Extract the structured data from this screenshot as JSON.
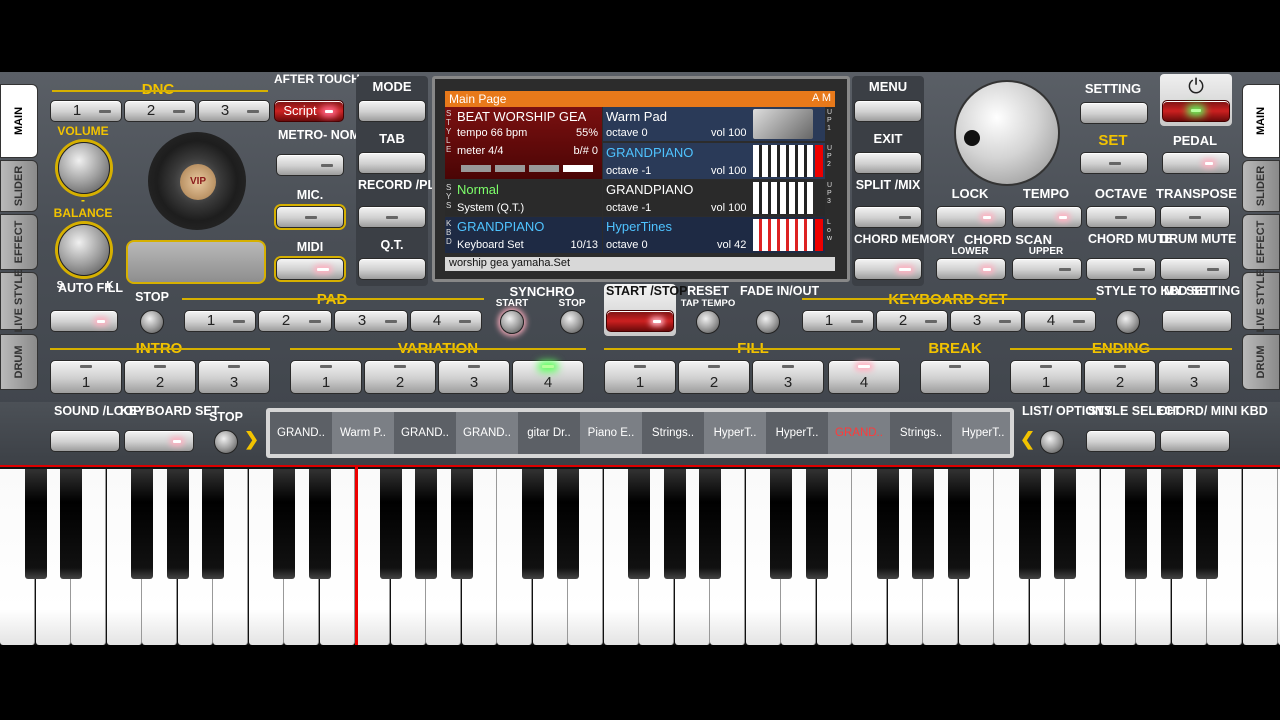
{
  "colors": {
    "accent_yellow": "#f2c300",
    "screen_header": "#e8791a",
    "cyan_text": "#4fc3ff",
    "green_text": "#7dff6a",
    "red_text": "#ff5a5a"
  },
  "side_tabs_left": [
    "MAIN",
    "SLIDER",
    "EFFECT",
    "LIVE STYLE",
    "DRUM"
  ],
  "side_tabs_right": [
    "MAIN",
    "SLIDER",
    "EFFECT",
    "LIVE STYLE",
    "DRUM"
  ],
  "dnc": {
    "title": "DNC",
    "buttons": [
      "1",
      "2",
      "3"
    ],
    "script": "Script"
  },
  "after_touch": "AFTER TOUCH",
  "metronome": "METRO- NOME",
  "mic": "MIC.",
  "midi": "MIDI",
  "volume": "VOLUME",
  "balance": "BALANCE",
  "balance_s": "S",
  "balance_k": "K",
  "vol_minus": "-",
  "vol_plus": "+",
  "vip_logo": "VIP",
  "mode_column": [
    "MODE",
    "TAB",
    "RECORD /PLAY",
    "Q.T."
  ],
  "screen": {
    "header": "Main Page",
    "header_right": "A M",
    "style_name": "BEAT WORSHIP GEA",
    "tempo": "tempo 66 bpm",
    "tempo_pct": "55%",
    "meter": "meter 4/4",
    "bsharp": "b/# 0",
    "normal": "Normal",
    "system": "System (Q.T.)",
    "kbd_voice": "GRANDPIANO",
    "kbd_set": "Keyboard Set",
    "kbd_count": "10/13",
    "up1_name": "Warm Pad",
    "up1_octave": "octave 0",
    "up1_vol": "vol 100",
    "up2_name": "GRANDPIANO",
    "up2_octave": "octave -1",
    "up2_vol": "vol 100",
    "up3_name": "GRANDPIANO",
    "up3_octave": "octave -1",
    "up3_vol": "vol 100",
    "low_name": "HyperTines",
    "low_octave": "octave 0",
    "low_vol": "vol 42",
    "footer": "worship gea yamaha.Set",
    "side_style": "S T Y L E",
    "side_sys": "S Y S",
    "side_kbd": "K B D",
    "side_up1": "U P 1",
    "side_up2": "U P 2",
    "side_up3": "U P 3",
    "side_low": "L o w"
  },
  "menu_column": [
    "MENU",
    "EXIT",
    "SPLIT /MIX",
    "CHORD MEMORY"
  ],
  "setting": "SETTING",
  "set": "SET",
  "pedal": "PEDAL",
  "power_icon": "⏻",
  "row_lock": {
    "lock": "LOCK",
    "tempo": "TEMPO",
    "octave": "OCTAVE",
    "transpose": "TRANSPOSE"
  },
  "chord_scan": "CHORD SCAN",
  "lower": "LOWER",
  "upper": "UPPER",
  "chord_mute": "CHORD MUTE",
  "drum_mute": "DRUM MUTE",
  "auto_fill": "AUTO FILL",
  "stop": "STOP",
  "pad": {
    "title": "PAD",
    "buttons": [
      "1",
      "2",
      "3",
      "4"
    ]
  },
  "synchro": "SYNCHRO",
  "synchro_start": "START",
  "synchro_stop": "STOP",
  "start_stop": "START /STOP",
  "reset": "RESET",
  "tap_tempo": "TAP TEMPO",
  "fade": "FADE IN/OUT",
  "keyboard_set": {
    "title": "KEYBOARD SET",
    "buttons": [
      "1",
      "2",
      "3",
      "4"
    ]
  },
  "style_to_kbd": "STYLE TO KBD SET",
  "my_setting": "MY SETTING",
  "intro": {
    "title": "INTRO",
    "buttons": [
      "1",
      "2",
      "3"
    ]
  },
  "variation": {
    "title": "VARIATION",
    "buttons": [
      "1",
      "2",
      "3",
      "4"
    ]
  },
  "fill": {
    "title": "FILL",
    "buttons": [
      "1",
      "2",
      "3",
      "4"
    ]
  },
  "break": "BREAK",
  "ending": {
    "title": "ENDING",
    "buttons": [
      "1",
      "2",
      "3"
    ]
  },
  "sound_loop": "SOUND /LOOP",
  "keyboard_set_btn": "KEYBOARD SET",
  "stop2": "STOP",
  "arrow_right": "❯",
  "arrow_left": "❮",
  "voice_strip": [
    "GRAND..",
    "Warm P..",
    "GRAND..",
    "GRAND..",
    "gitar Dr..",
    "Piano E..",
    "Strings..",
    "HyperT..",
    "HyperT..",
    "GRAND..",
    "Strings..",
    "HyperT.."
  ],
  "list_options": "LIST/ OPTIONS",
  "style_select": "STYLE SELECT",
  "chord_mini_kbd": "CHORD/ MINI KBD"
}
